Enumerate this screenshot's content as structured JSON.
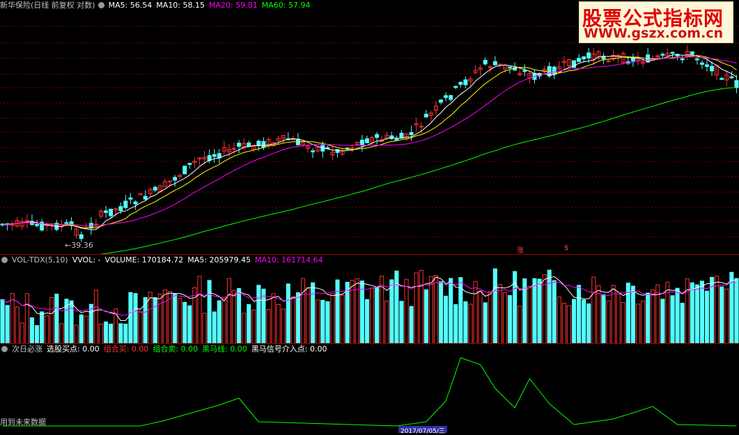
{
  "price_panel": {
    "title": "新华保险(日线 前复权 对数)",
    "ma5": "MA5: 56.54",
    "ma10": "MA10: 58.15",
    "ma20": "MA20: 59.81",
    "ma60": "MA60: 57.94",
    "low_label": "←39.36",
    "signal_1": "涨",
    "signal_2": "$"
  },
  "vol_panel": {
    "title": "VOL-TDX(5,10)",
    "vvol": "VVOL: -",
    "volume": "VOLUME: 170184.72",
    "ma5": "MA5: 205979.45",
    "ma10": "MA10: 161714.64"
  },
  "ind_panel": {
    "title": "次日必涨",
    "buy": "选股买点: 0.00",
    "combo_buy": "组合买: 0.00",
    "combo_sell": "组合卖: 0.00",
    "horse": "黑马线: 0.00",
    "horse_signal": "黑马信号介入点: 0.00",
    "footer": "用到未来数据",
    "date": "2017/07/05/三"
  },
  "watermark": {
    "line1": "股票公式指标网",
    "line2": "WWW.gszx.com.cn"
  },
  "colors": {
    "up": "#ff3232",
    "down": "#54ffff",
    "ma5": "#ffffff",
    "ma10": "#ffff00",
    "ma20": "#ff00ff",
    "ma60": "#00ff00",
    "grid": "#800000"
  }
}
